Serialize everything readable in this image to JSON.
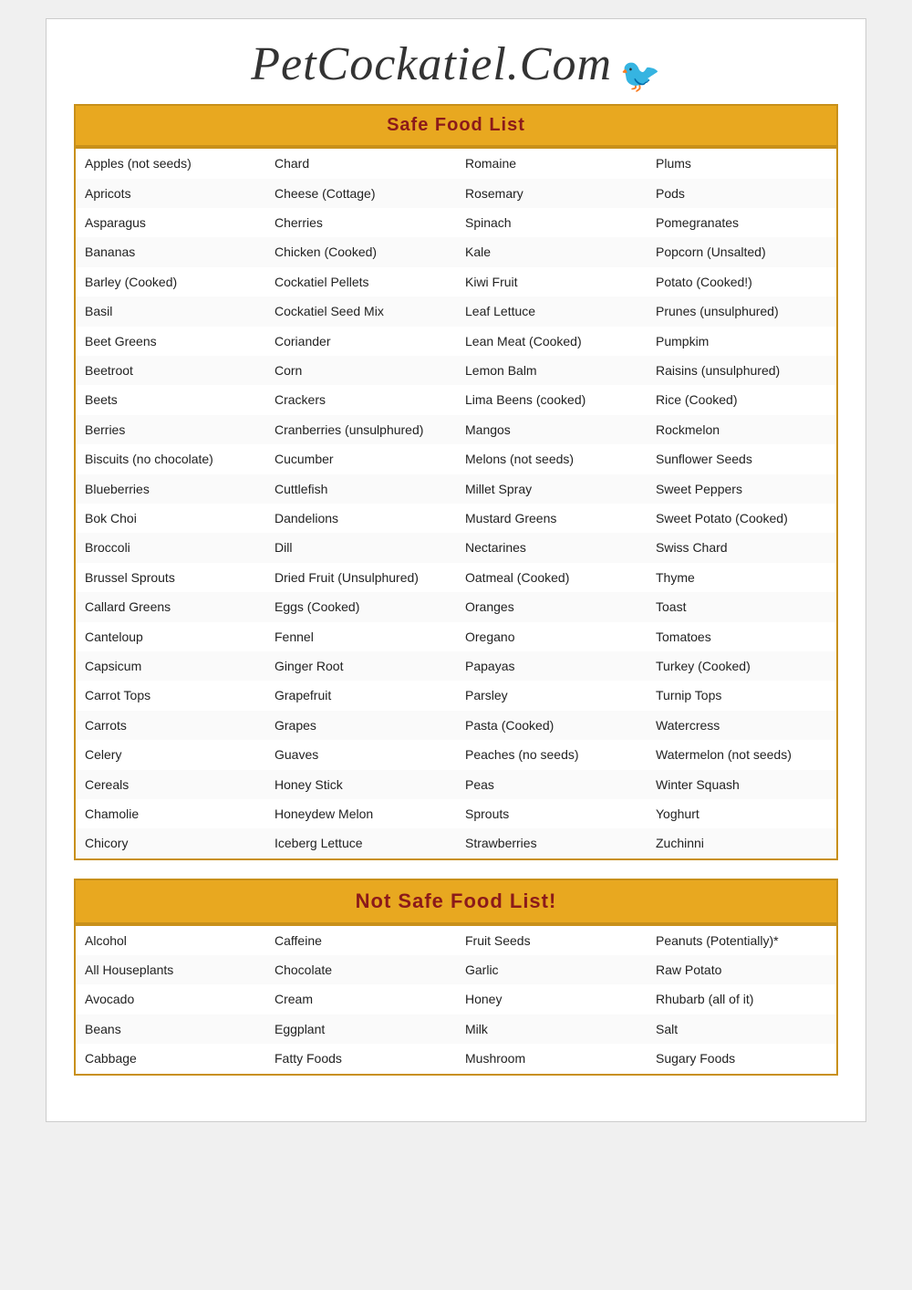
{
  "site": {
    "title": "PetCockatiel.Com",
    "bird_symbol": "🐦"
  },
  "safe_header": "Safe Food List",
  "not_safe_header": "Not Safe Food List!",
  "safe_foods": [
    [
      "Apples (not seeds)",
      "Chard",
      "Romaine",
      "Plums"
    ],
    [
      "Apricots",
      "Cheese (Cottage)",
      "Rosemary",
      "Pods"
    ],
    [
      "Asparagus",
      "Cherries",
      "Spinach",
      "Pomegranates"
    ],
    [
      "Bananas",
      "Chicken (Cooked)",
      "Kale",
      "Popcorn (Unsalted)"
    ],
    [
      "Barley (Cooked)",
      "Cockatiel Pellets",
      "Kiwi Fruit",
      "Potato (Cooked!)"
    ],
    [
      "Basil",
      "Cockatiel Seed Mix",
      "Leaf Lettuce",
      "Prunes (unsulphured)"
    ],
    [
      "Beet Greens",
      "Coriander",
      "Lean Meat (Cooked)",
      "Pumpkim"
    ],
    [
      "Beetroot",
      "Corn",
      "Lemon Balm",
      "Raisins (unsulphured)"
    ],
    [
      "Beets",
      "Crackers",
      "Lima Beens (cooked)",
      "Rice (Cooked)"
    ],
    [
      "Berries",
      "Cranberries (unsulphured)",
      "Mangos",
      "Rockmelon"
    ],
    [
      "Biscuits (no chocolate)",
      "Cucumber",
      "Melons (not seeds)",
      "Sunflower Seeds"
    ],
    [
      "Blueberries",
      "Cuttlefish",
      "Millet Spray",
      "Sweet Peppers"
    ],
    [
      "Bok Choi",
      "Dandelions",
      "Mustard Greens",
      "Sweet Potato (Cooked)"
    ],
    [
      "Broccoli",
      "Dill",
      "Nectarines",
      "Swiss Chard"
    ],
    [
      "Brussel Sprouts",
      "Dried Fruit (Unsulphured)",
      "Oatmeal (Cooked)",
      "Thyme"
    ],
    [
      "Callard Greens",
      "Eggs (Cooked)",
      "Oranges",
      "Toast"
    ],
    [
      "Canteloup",
      "Fennel",
      "Oregano",
      "Tomatoes"
    ],
    [
      "Capsicum",
      "Ginger Root",
      "Papayas",
      "Turkey (Cooked)"
    ],
    [
      "Carrot Tops",
      "Grapefruit",
      "Parsley",
      "Turnip Tops"
    ],
    [
      "Carrots",
      "Grapes",
      "Pasta (Cooked)",
      "Watercress"
    ],
    [
      "Celery",
      "Guaves",
      "Peaches (no seeds)",
      "Watermelon (not seeds)"
    ],
    [
      "Cereals",
      "Honey Stick",
      "Peas",
      "Winter Squash"
    ],
    [
      "Chamolie",
      "Honeydew Melon",
      "Sprouts",
      "Yoghurt"
    ],
    [
      "Chicory",
      "Iceberg Lettuce",
      "Strawberries",
      "Zuchinni"
    ]
  ],
  "not_safe_foods": [
    [
      "Alcohol",
      "Caffeine",
      "Fruit Seeds",
      "Peanuts (Potentially)*"
    ],
    [
      "All Houseplants",
      "Chocolate",
      "Garlic",
      "Raw Potato"
    ],
    [
      "Avocado",
      "Cream",
      "Honey",
      "Rhubarb (all of it)"
    ],
    [
      "Beans",
      "Eggplant",
      "Milk",
      "Salt"
    ],
    [
      "Cabbage",
      "Fatty Foods",
      "Mushroom",
      "Sugary Foods"
    ]
  ]
}
